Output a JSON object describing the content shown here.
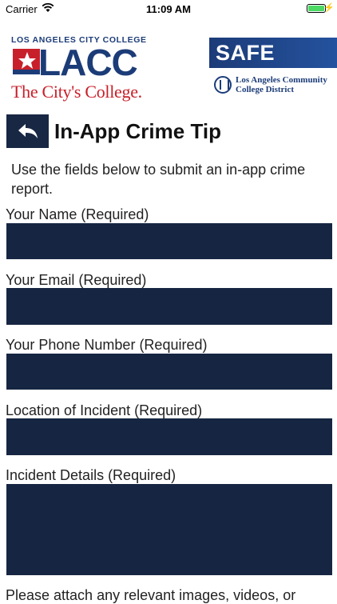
{
  "status_bar": {
    "carrier": "Carrier",
    "time": "11:09 AM"
  },
  "header": {
    "college_name": "LOS ANGELES CITY COLLEGE",
    "college_logo_word": "LACC",
    "college_tagline": "The City's College.",
    "safe_label": "SAFE",
    "district_line1": "Los Angeles Community",
    "district_line2": "College District"
  },
  "page": {
    "title": "In-App Crime Tip",
    "intro": "Use the fields below to submit an in-app crime report."
  },
  "form": {
    "name_label": "Your Name (Required)",
    "name_value": "",
    "email_label": "Your Email (Required)",
    "email_value": "",
    "phone_label": "Your Phone Number (Required)",
    "phone_value": "",
    "location_label": "Location of Incident (Required)",
    "location_value": "",
    "details_label": "Incident Details (Required)",
    "details_value": ""
  },
  "footer_text": "Please attach any relevant images, videos, or",
  "colors": {
    "navy": "#182743",
    "brand_blue": "#1c3c78",
    "brand_red": "#c8202a"
  },
  "icons": {
    "back": "back-arrow-icon",
    "wifi": "wifi-icon",
    "battery": "battery-icon"
  }
}
